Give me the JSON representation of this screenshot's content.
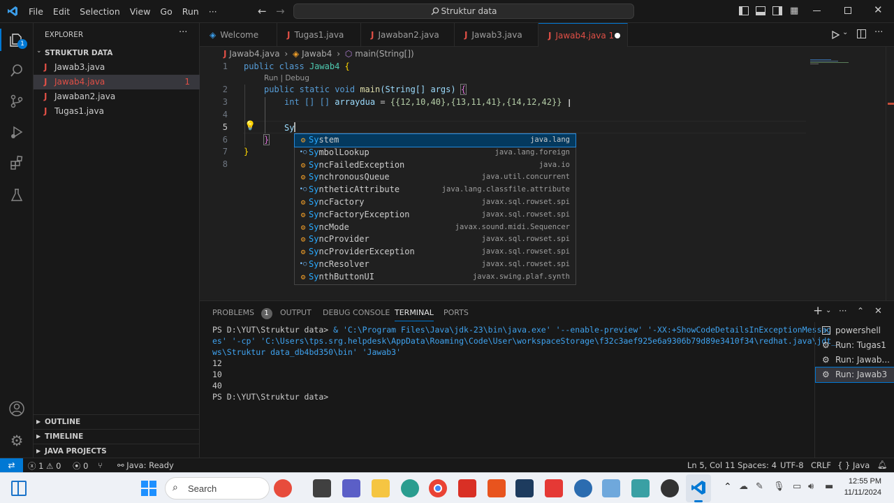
{
  "titlebar": {
    "menu": [
      "File",
      "Edit",
      "Selection",
      "View",
      "Go",
      "Run"
    ],
    "more": "···",
    "search_text": "Struktur data"
  },
  "sidebar": {
    "header": "EXPLORER",
    "more": "···",
    "folder": "STRUKTUR DATA",
    "files": [
      {
        "name": "Jawab3.java",
        "badge": ""
      },
      {
        "name": "Jawab4.java",
        "badge": "1"
      },
      {
        "name": "Jawaban2.java",
        "badge": ""
      },
      {
        "name": "Tugas1.java",
        "badge": ""
      }
    ],
    "sections": [
      "OUTLINE",
      "TIMELINE",
      "JAVA PROJECTS"
    ]
  },
  "activity_badge": "1",
  "tabs": [
    {
      "label": "Welcome"
    },
    {
      "label": "Tugas1.java"
    },
    {
      "label": "Jawaban2.java"
    },
    {
      "label": "Jawab3.java"
    },
    {
      "label": "Jawab4.java 1"
    }
  ],
  "breadcrumb": {
    "file": "Jawab4.java",
    "class": "Jawab4",
    "method": "main(String[])"
  },
  "editor": {
    "line_numbers": [
      "1",
      "2",
      "3",
      "4",
      "5",
      "6",
      "7",
      "8"
    ],
    "codelens": "Run | Debug",
    "line1": {
      "kw1": "public",
      "kw2": "class",
      "name": "Jawab4",
      "brace": "{"
    },
    "line2": {
      "kw1": "public",
      "kw2": "static",
      "kw3": "void",
      "fn": "main",
      "params": "(String[] args)",
      "brace": "{"
    },
    "line3": {
      "type": "int",
      "dims": "[] []",
      "var": "arraydua",
      "eq": "=",
      "value": "{{12,10,40},{13,11,41},{14,12,42}}"
    },
    "line5": "Sy",
    "line6": "}",
    "line7": "}"
  },
  "suggestions": [
    {
      "prefix": "Sy",
      "rest": "stem",
      "pkg": "java.lang",
      "icon": "class-icon",
      "selected": true
    },
    {
      "prefix": "Sy",
      "rest": "mbolLookup",
      "pkg": "java.lang.foreign",
      "icon": "interface-icon"
    },
    {
      "prefix": "Sy",
      "rest": "ncFailedException",
      "pkg": "java.io",
      "icon": "class-icon"
    },
    {
      "prefix": "Sy",
      "rest": "nchronousQueue",
      "pkg": "java.util.concurrent",
      "icon": "class-icon"
    },
    {
      "prefix": "Sy",
      "rest": "ntheticAttribute",
      "pkg": "java.lang.classfile.attribute",
      "icon": "interface-icon"
    },
    {
      "prefix": "Sy",
      "rest": "ncFactory",
      "pkg": "javax.sql.rowset.spi",
      "icon": "class-icon"
    },
    {
      "prefix": "Sy",
      "rest": "ncFactoryException",
      "pkg": "javax.sql.rowset.spi",
      "icon": "class-icon"
    },
    {
      "prefix": "Sy",
      "rest": "ncMode",
      "pkg": "javax.sound.midi.Sequencer",
      "icon": "class-icon"
    },
    {
      "prefix": "Sy",
      "rest": "ncProvider",
      "pkg": "javax.sql.rowset.spi",
      "icon": "class-icon"
    },
    {
      "prefix": "Sy",
      "rest": "ncProviderException",
      "pkg": "javax.sql.rowset.spi",
      "icon": "class-icon"
    },
    {
      "prefix": "Sy",
      "rest": "ncResolver",
      "pkg": "javax.sql.rowset.spi",
      "icon": "interface-icon"
    },
    {
      "prefix": "Sy",
      "rest": "nthButtonUI",
      "pkg": "javax.swing.plaf.synth",
      "icon": "class-icon"
    }
  ],
  "panel": {
    "tabs": [
      "PROBLEMS",
      "OUTPUT",
      "DEBUG CONSOLE",
      "TERMINAL",
      "PORTS"
    ],
    "problems_badge": "1",
    "terminal": {
      "prompt1": "PS D:\\YUT\\Struktur data>",
      "cmd_line1": " & 'C:\\Program Files\\Java\\jdk-23\\bin\\java.exe' '--enable-preview' '-XX:+ShowCodeDetailsInExceptionMessag",
      "cmd_line2": "es' '-cp' 'C:\\Users\\tps.srg.helpdesk\\AppData\\Roaming\\Code\\User\\workspaceStorage\\f32c3aef925e6a9306b79d89e3410f34\\redhat.java\\jdt_",
      "cmd_line3": "ws\\Struktur data_db4bd350\\bin' 'Jawab3'",
      "outputs": [
        "12",
        "10",
        "40"
      ],
      "prompt2": "PS D:\\YUT\\Struktur data>"
    },
    "terminal_list": [
      "powershell",
      "Run: Tugas1",
      "Run: Jawab...",
      "Run: Jawab3"
    ]
  },
  "statusbar": {
    "errors": "1",
    "warnings": "0",
    "ports": "0",
    "java": "Java: Ready",
    "position": "Ln 5, Col 11",
    "spaces": "Spaces: 4",
    "encoding": "UTF-8",
    "eol": "CRLF",
    "lang_braces": "{ }",
    "language": "Java"
  },
  "taskbar": {
    "search": "Search",
    "time": "12:55 PM",
    "date": "11/11/2024"
  },
  "colors": {
    "accent": "#0078d4",
    "java_red": "#e04f46",
    "match_blue": "#2aaaff"
  }
}
